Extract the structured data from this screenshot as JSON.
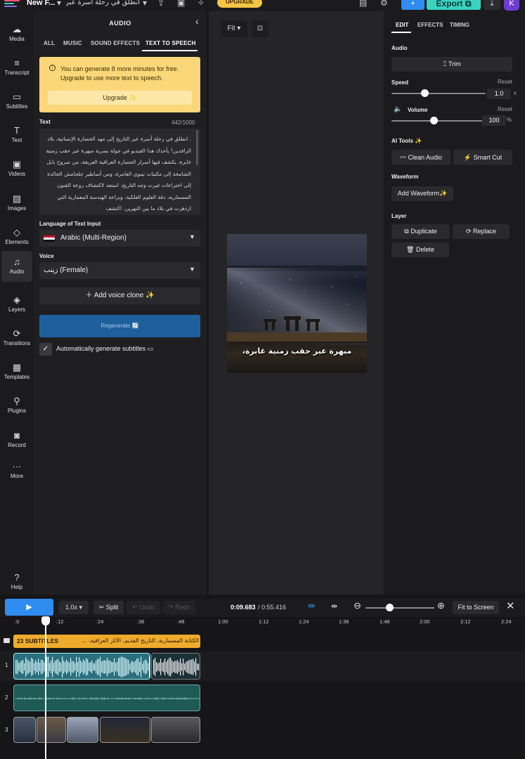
{
  "topbar": {
    "project_name": "New F...",
    "project_title": "انطلق في رحلة أسرة عبر...",
    "upgrade_label": "UPGRADE",
    "export_label": "Export",
    "avatar_initial": "K"
  },
  "leftnav": {
    "items": [
      {
        "label": "Media",
        "icon": "☁"
      },
      {
        "label": "Transcript",
        "icon": "≡"
      },
      {
        "label": "Subtitles",
        "icon": "▭"
      },
      {
        "label": "Text",
        "icon": "T"
      },
      {
        "label": "Videos",
        "icon": "▣"
      },
      {
        "label": "Images",
        "icon": "▨"
      },
      {
        "label": "Elements",
        "icon": "◇"
      },
      {
        "label": "Audio",
        "icon": "♫"
      },
      {
        "label": "Layers",
        "icon": "◈"
      },
      {
        "label": "Transitions",
        "icon": "⟳"
      },
      {
        "label": "Templates",
        "icon": "▦"
      },
      {
        "label": "Plugins",
        "icon": "⚲"
      },
      {
        "label": "Record",
        "icon": "◙"
      },
      {
        "label": "More",
        "icon": "···"
      }
    ],
    "help_label": "Help"
  },
  "audio_panel": {
    "title": "AUDIO",
    "tabs": [
      "ALL",
      "MUSIC",
      "SOUND EFFECTS",
      "TEXT TO SPEECH"
    ],
    "active_tab": "TEXT TO SPEECH",
    "notice": {
      "text": "You can generate 8 more minutes for free. Upgrade to use more text to speech.",
      "button": "Upgrade ✨"
    },
    "text_label": "Text",
    "char_count": "442/1000",
    "tts_text": ". انطلق في رحلة أسرة عبر التاريخ إلى مهد الحضارة الإنسانية، بلاد الرافدين! يأخذك هذا الفيديو في جولة بصرية مبهرة عبر حقب زمنية غابرة، يكشف فيها أسرار الحضارة العراقية العريقة، من صروح بابل الشامخة إلى مكتبات نينوى العامرة، ومن أساطير جلجامش الخالدة إلى اختراعات غيرت وجه التاريخ. استعد لاكتشاف روعة الفنون المسمارية، دقة العلوم الفلكية، وبراعة الهندسة المعمارية التي ازدهرت في بلاد ما بين النهرين. اكتشف",
    "language_label": "Language of Text Input",
    "language_value": "Arabic (Multi-Region)",
    "voice_label": "Voice",
    "voice_value": "زينب (Female)",
    "voice_clone_label": "Add voice clone ✨",
    "regenerate_label": "Regenerate 🔄",
    "auto_subtitles_label": "Automatically generate subtitles"
  },
  "canvas": {
    "fit_label": "Fit",
    "caption": "مبهرة عبر حقب زمنية غابرة،"
  },
  "right_panel": {
    "tabs": [
      "EDIT",
      "EFFECTS",
      "TIMING"
    ],
    "active_tab": "EDIT",
    "audio_label": "Audio",
    "trim_label": "Trim",
    "speed_label": "Speed",
    "speed_value": "1.0",
    "speed_unit": "x",
    "speed_level": 0.35,
    "reset_label": "Reset",
    "volume_label": "Volume",
    "volume_value": "100",
    "volume_unit": "%",
    "volume_level": 0.45,
    "ai_tools_label": "AI Tools ✨",
    "clean_audio_label": "Clean Audio",
    "smart_cut_label": "Smart Cut",
    "waveform_label": "Waveform",
    "add_waveform_label": "Add Waveform✨",
    "layer_label": "Layer",
    "duplicate_label": "Duplicate",
    "replace_label": "Replace",
    "delete_label": "Delete"
  },
  "timeline": {
    "speed": "1.0x",
    "split_label": "Split",
    "undo_label": "Undo",
    "redo_label": "Redo",
    "current_time": "0:09.683",
    "total_time": "/ 0:55.416",
    "fit_to_screen_label": "Fit to Screen",
    "zoom_level": 0.35,
    "ticks": [
      ":0",
      ":12",
      ":24",
      ":36",
      ":48",
      "1:00",
      "1:12",
      "1:24",
      "1:36",
      "1:48",
      "2:00",
      "2:12",
      "2:24"
    ],
    "subtitles_badge": "23 SUBTITLES",
    "subtitles_preview": "الكتابة المسمارية، التاريخ القديم، الآثار العراقية، ...",
    "track_numbers": [
      "1",
      "2",
      "3"
    ]
  },
  "colors": {
    "accent_blue": "#2f8cf0",
    "export_teal": "#3ad3c2",
    "upgrade_yellow": "#f4c542",
    "notice_bg": "#fbd779",
    "subtitle_track": "#efab2c",
    "avatar_purple": "#6e3bd6"
  }
}
